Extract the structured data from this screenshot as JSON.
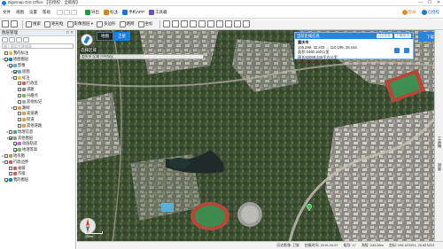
{
  "app": {
    "title": "Bigemap GIS Office  【已授权：全能版】",
    "win_controls": [
      "—",
      "☐",
      "✕"
    ]
  },
  "menu": {
    "items": [
      "文件",
      "视图",
      "设置",
      "帮助"
    ],
    "quick_tools": [
      {
        "label": "导出",
        "color": "#1a9f36",
        "icon": "export-icon"
      },
      {
        "label": "标注",
        "color": "#e0801b",
        "icon": "label-icon"
      },
      {
        "label": "手机APP",
        "color": "#1a7ad4",
        "icon": "phone-icon"
      },
      {
        "label": "工具箱",
        "color": "#6a4fc9",
        "icon": "toolbox-icon"
      }
    ],
    "user": [
      {
        "label": "登录",
        "color": "#e9892f"
      },
      {
        "label": "已授权",
        "color": "#1a7ad4"
      }
    ]
  },
  "toolbar": {
    "buttons": [
      {
        "label": "搜索",
        "icon": "search-icon"
      },
      {
        "label": "矩形框",
        "icon": "rectangle-icon"
      },
      {
        "label": "影像图层 ▾",
        "icon": "layer-icon"
      },
      {
        "label": "多边形",
        "icon": "polygon-icon"
      },
      {
        "label": "路网",
        "icon": "road-icon"
      },
      {
        "label": "坐标",
        "icon": "coordinate-icon"
      }
    ]
  },
  "layer_panel": {
    "title": "图层管理",
    "search_placeholder": "输入图层名称搜索",
    "tree": [
      {
        "label": "我的标注",
        "indent": 0,
        "checked": false,
        "twist": "",
        "icon_color": "#e8c04a"
      },
      {
        "label": "地图图层",
        "indent": 0,
        "checked": true,
        "twist": "▾",
        "icon_color": "#1a7ad4"
      },
      {
        "label": "影像",
        "indent": 1,
        "checked": true,
        "twist": "▾",
        "icon_color": "#6da3d8"
      },
      {
        "label": "底图",
        "indent": 2,
        "checked": true,
        "twist": "▾",
        "icon_color": "#6da3d8"
      },
      {
        "label": "标注",
        "indent": 2,
        "checked": false,
        "twist": "▾",
        "icon_color": "#e8c04a"
      },
      {
        "label": "行政区",
        "indent": 3,
        "checked": false,
        "twist": "",
        "icon_color": "#d85b5b"
      },
      {
        "label": "道路",
        "indent": 3,
        "checked": false,
        "twist": "",
        "icon_color": "#888888"
      },
      {
        "label": "兴趣点",
        "indent": 3,
        "checked": false,
        "twist": "",
        "icon_color": "#7fb35e"
      },
      {
        "label": "其他标记",
        "indent": 3,
        "checked": false,
        "twist": "",
        "icon_color": "#aaaaaa"
      },
      {
        "label": "路网",
        "indent": 2,
        "checked": false,
        "twist": "▾",
        "icon_color": "#d8a040"
      },
      {
        "label": "高速路",
        "indent": 3,
        "checked": false,
        "twist": "",
        "icon_color": "#d8a040"
      },
      {
        "label": "街道",
        "indent": 3,
        "checked": false,
        "twist": "",
        "icon_color": "#d8a040"
      },
      {
        "label": "其他道路",
        "indent": 3,
        "checked": false,
        "twist": "",
        "icon_color": "#d8a040"
      },
      {
        "label": "地理信息",
        "indent": 1,
        "checked": false,
        "twist": "▸",
        "icon_color": "#4aa37a"
      },
      {
        "label": "其他图层",
        "indent": 1,
        "checked": true,
        "twist": "▾",
        "icon_color": "#999999"
      },
      {
        "label": "动画轨迹",
        "indent": 2,
        "checked": true,
        "twist": "",
        "icon_color": "#c46ec9"
      },
      {
        "label": "地理等高",
        "indent": 2,
        "checked": true,
        "twist": "",
        "icon_color": "#7fb35e"
      },
      {
        "label": "地形图",
        "indent": 0,
        "checked": false,
        "twist": "▸",
        "icon_color": "#b89454"
      },
      {
        "label": "行政边界",
        "indent": 0,
        "checked": false,
        "twist": "▾",
        "icon_color": "#d85b5b"
      },
      {
        "label": "省级",
        "indent": 1,
        "checked": false,
        "twist": "",
        "icon_color": "#d85b5b"
      },
      {
        "label": "市级",
        "indent": 1,
        "checked": false,
        "twist": "",
        "icon_color": "#d85b5b"
      },
      {
        "label": "我的图层",
        "indent": 0,
        "checked": true,
        "twist": "",
        "icon_color": "#1a7ad4"
      }
    ]
  },
  "map": {
    "tabs": [
      {
        "label": "地图",
        "active": false
      },
      {
        "label": "卫星",
        "active": true
      }
    ],
    "region_label": "选择区域",
    "region_value": "重庆市 区域 沙坪坝区 ...",
    "position_text": "西藏大学",
    "info_popup": {
      "header": "当前区域信息",
      "share_buttons": [
        "QQ交流",
        "下载导出"
      ],
      "title": "重庆市",
      "lines": [
        "105.289, 32.203 → 110.195, 28.164",
        "面积:3460.160公里",
        "周长82088.345平方公里"
      ]
    },
    "hint_box": "下载任务",
    "scale_label": "100m"
  },
  "right_dock": {
    "tabs": [
      "工具箱",
      "测量"
    ]
  },
  "statusbar": {
    "items": [
      "历史影像: 卫星",
      "拍摄时间: 2019-04-07",
      "级别: 17",
      "海拔: 244.66m",
      "坐标: 106.423391, 29.823203"
    ]
  }
}
